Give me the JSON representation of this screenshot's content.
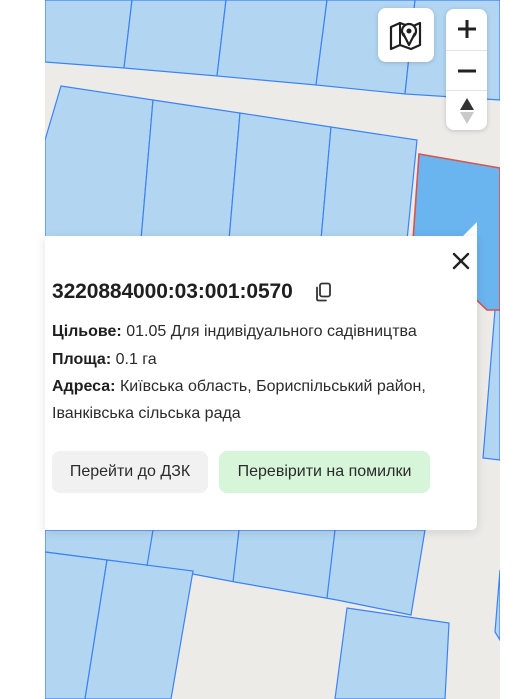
{
  "map": {
    "colors": {
      "background": "#ecebe8",
      "parcel_fill": "#b2d6f2",
      "parcel_stroke": "#3b82f6",
      "selected_fill": "#6ab4ef",
      "selected_stroke": "#d9534f"
    }
  },
  "controls": {
    "layers_icon": "map-pin-layers-icon",
    "zoom_in": "+",
    "zoom_out": "−",
    "compass_icon": "north-compass-icon"
  },
  "popup": {
    "cadastral_number": "3220884000:03:001:0570",
    "close_icon": "close-icon",
    "copy_icon": "copy-icon",
    "purpose_label": "Цільове:",
    "purpose_value": "01.05 Для індивідуального садівництва",
    "area_label": "Площа:",
    "area_value": "0.1 га",
    "address_label": "Адреса:",
    "address_value": "Київська область, Бориспільський район, Іванківська сільська рада",
    "btn_dzk": "Перейти до ДЗК",
    "btn_check": "Перевірити на помилки"
  }
}
